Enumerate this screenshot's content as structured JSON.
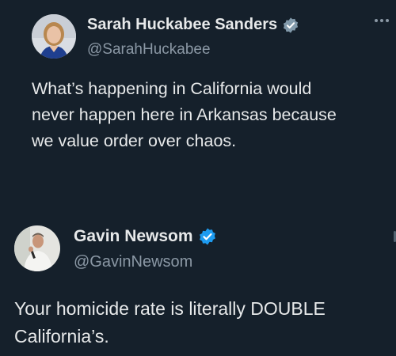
{
  "tweets": [
    {
      "display_name": "Sarah Huckabee Sanders",
      "handle": "@SarahHuckabee",
      "verified_badge": "verified-gray-badge",
      "badge_color": "#829aab",
      "text": "What’s happening in California would\nnever happen here in Arkansas because\nwe value order over chaos.",
      "menu_icon": "more-horizontal-icon"
    },
    {
      "display_name": "Gavin Newsom",
      "handle": "@GavinNewsom",
      "verified_badge": "verified-blue-badge",
      "badge_color": "#1d9bf0",
      "text": "Your homicide rate is literally DOUBLE\nCalifornia’s."
    }
  ],
  "theme": {
    "background": "#15202b",
    "text": "#e7e9ea",
    "muted": "#8b98a5"
  }
}
